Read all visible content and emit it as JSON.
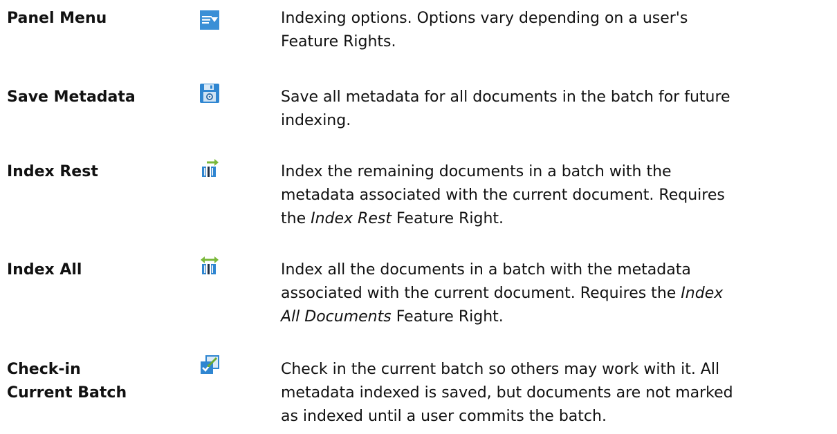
{
  "rows": [
    {
      "term": "Panel Menu",
      "icon": "panel-menu-icon",
      "desc_lines": [
        "Indexing options. Options vary depending on a user's",
        "Feature Rights."
      ]
    },
    {
      "term": "Save Metadata",
      "icon": "save-metadata-icon",
      "desc_lines": [
        "Save all metadata for all documents in the batch for future",
        "indexing."
      ]
    },
    {
      "term": "Index Rest",
      "icon": "index-rest-icon",
      "desc_lines": [
        "Index the remaining documents in a batch with the",
        "metadata associated with the current document. Requires"
      ],
      "desc_line3": {
        "pre": "the ",
        "em": "Index Rest",
        "post": " Feature Right."
      }
    },
    {
      "term": "Index All",
      "icon": "index-all-icon",
      "desc_lines": [
        "Index all the documents in a batch with the metadata"
      ],
      "desc_line2": {
        "pre": "associated with the current document. Requires the ",
        "em": "Index"
      },
      "desc_line3": {
        "em": "All Documents",
        "post": " Feature Right."
      }
    },
    {
      "term_lines": [
        "Check-in",
        "Current Batch"
      ],
      "icon": "check-in-icon",
      "desc_lines": [
        "Check in the current batch so others may work with it. All",
        "metadata indexed is saved, but documents are not marked",
        "as indexed until a user commits the batch."
      ]
    }
  ]
}
